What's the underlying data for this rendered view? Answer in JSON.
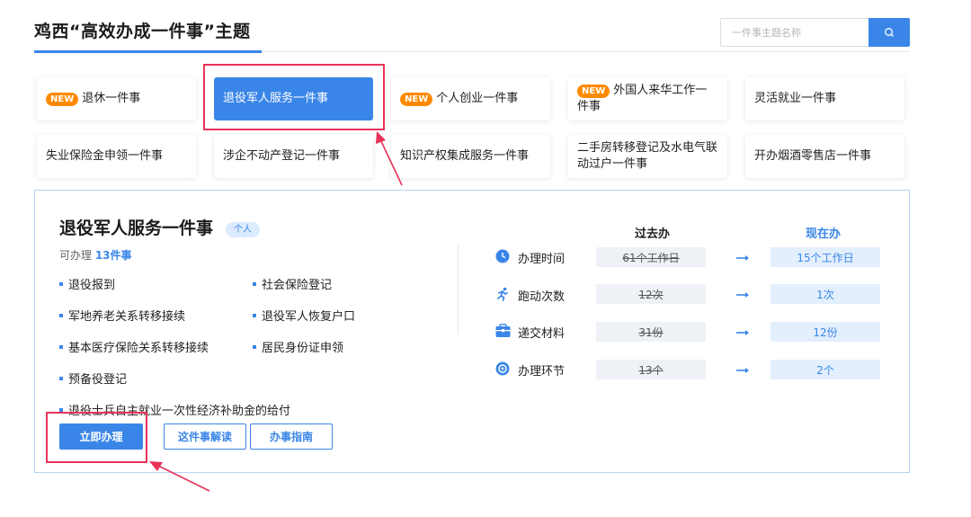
{
  "header": {
    "title": "鸡西“高效办成一件事”主题",
    "search_placeholder": "一件事主题名称",
    "search_icon": "search-icon"
  },
  "tiles": [
    {
      "label": "退休一件事",
      "badge": "NEW",
      "active": false
    },
    {
      "label": "退役军人服务一件事",
      "badge": "",
      "active": true
    },
    {
      "label": "个人创业一件事",
      "badge": "NEW",
      "active": false
    },
    {
      "label": "外国人来华工作一件事",
      "badge": "NEW",
      "active": false
    },
    {
      "label": "灵活就业一件事",
      "badge": "",
      "active": false
    },
    {
      "label": "失业保险金申领一件事",
      "badge": "",
      "active": false
    },
    {
      "label": "涉企不动产登记一件事",
      "badge": "",
      "active": false
    },
    {
      "label": "知识产权集成服务一件事",
      "badge": "",
      "active": false
    },
    {
      "label": "二手房转移登记及水电气联动过户一件事",
      "badge": "",
      "active": false
    },
    {
      "label": "开办烟酒零售店一件事",
      "badge": "",
      "active": false
    }
  ],
  "detail": {
    "title": "退役军人服务一件事",
    "tag": "个人",
    "count_prefix": "可办理 ",
    "count_value": "13件事",
    "items": [
      "退役报到",
      "社会保险登记",
      "军地养老关系转移接续",
      "退役军人恢复户口",
      "基本医疗保险关系转移接续",
      "居民身份证申领",
      "预备役登记",
      "退役士兵自主就业一次性经济补助金的给付"
    ],
    "buttons": {
      "apply": "立即办理",
      "interpret": "这件事解读",
      "guide": "办事指南"
    },
    "compare": {
      "past_label": "过去办",
      "now_label": "现在办",
      "rows": [
        {
          "label": "办理时间",
          "icon": "clock-icon",
          "past": "61个工作日",
          "now": "15个工作日"
        },
        {
          "label": "跑动次数",
          "icon": "running-icon",
          "past": "12次",
          "now": "1次"
        },
        {
          "label": "递交材料",
          "icon": "folder-icon",
          "past": "31份",
          "now": "12份"
        },
        {
          "label": "办理环节",
          "icon": "steps-icon",
          "past": "13个",
          "now": "2个"
        }
      ]
    }
  },
  "colors": {
    "accent": "#3a86e8",
    "badge": "#ff8a00",
    "annotation": "#e8325a"
  }
}
